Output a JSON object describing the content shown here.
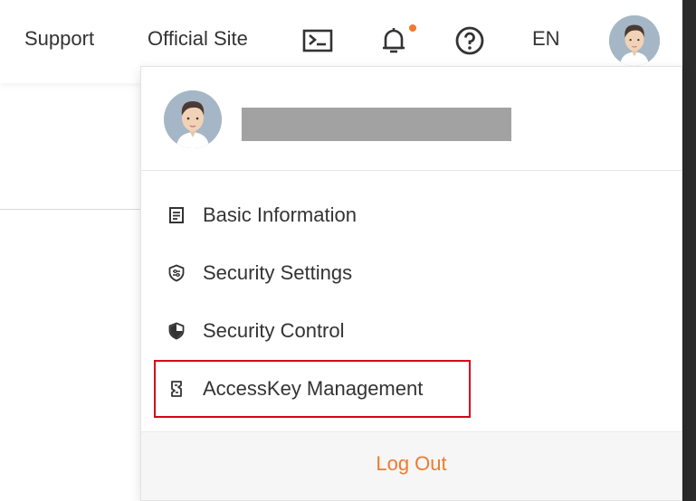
{
  "header": {
    "links": [
      "Support",
      "Official Site"
    ],
    "language": "EN",
    "icons": [
      "terminal-icon",
      "bell-icon",
      "help-icon"
    ],
    "notification_dot_color": "#ed7b2f"
  },
  "account_menu": {
    "items": [
      {
        "label": "Basic Information",
        "icon": "document-icon"
      },
      {
        "label": "Security Settings",
        "icon": "shield-settings-icon"
      },
      {
        "label": "Security Control",
        "icon": "shield-icon"
      },
      {
        "label": "AccessKey Management",
        "icon": "accesskey-icon",
        "highlighted": true
      }
    ],
    "logout_label": "Log Out"
  },
  "colors": {
    "accent": "#ed7b2f",
    "highlight_border": "#d9001b",
    "text": "#333333"
  }
}
